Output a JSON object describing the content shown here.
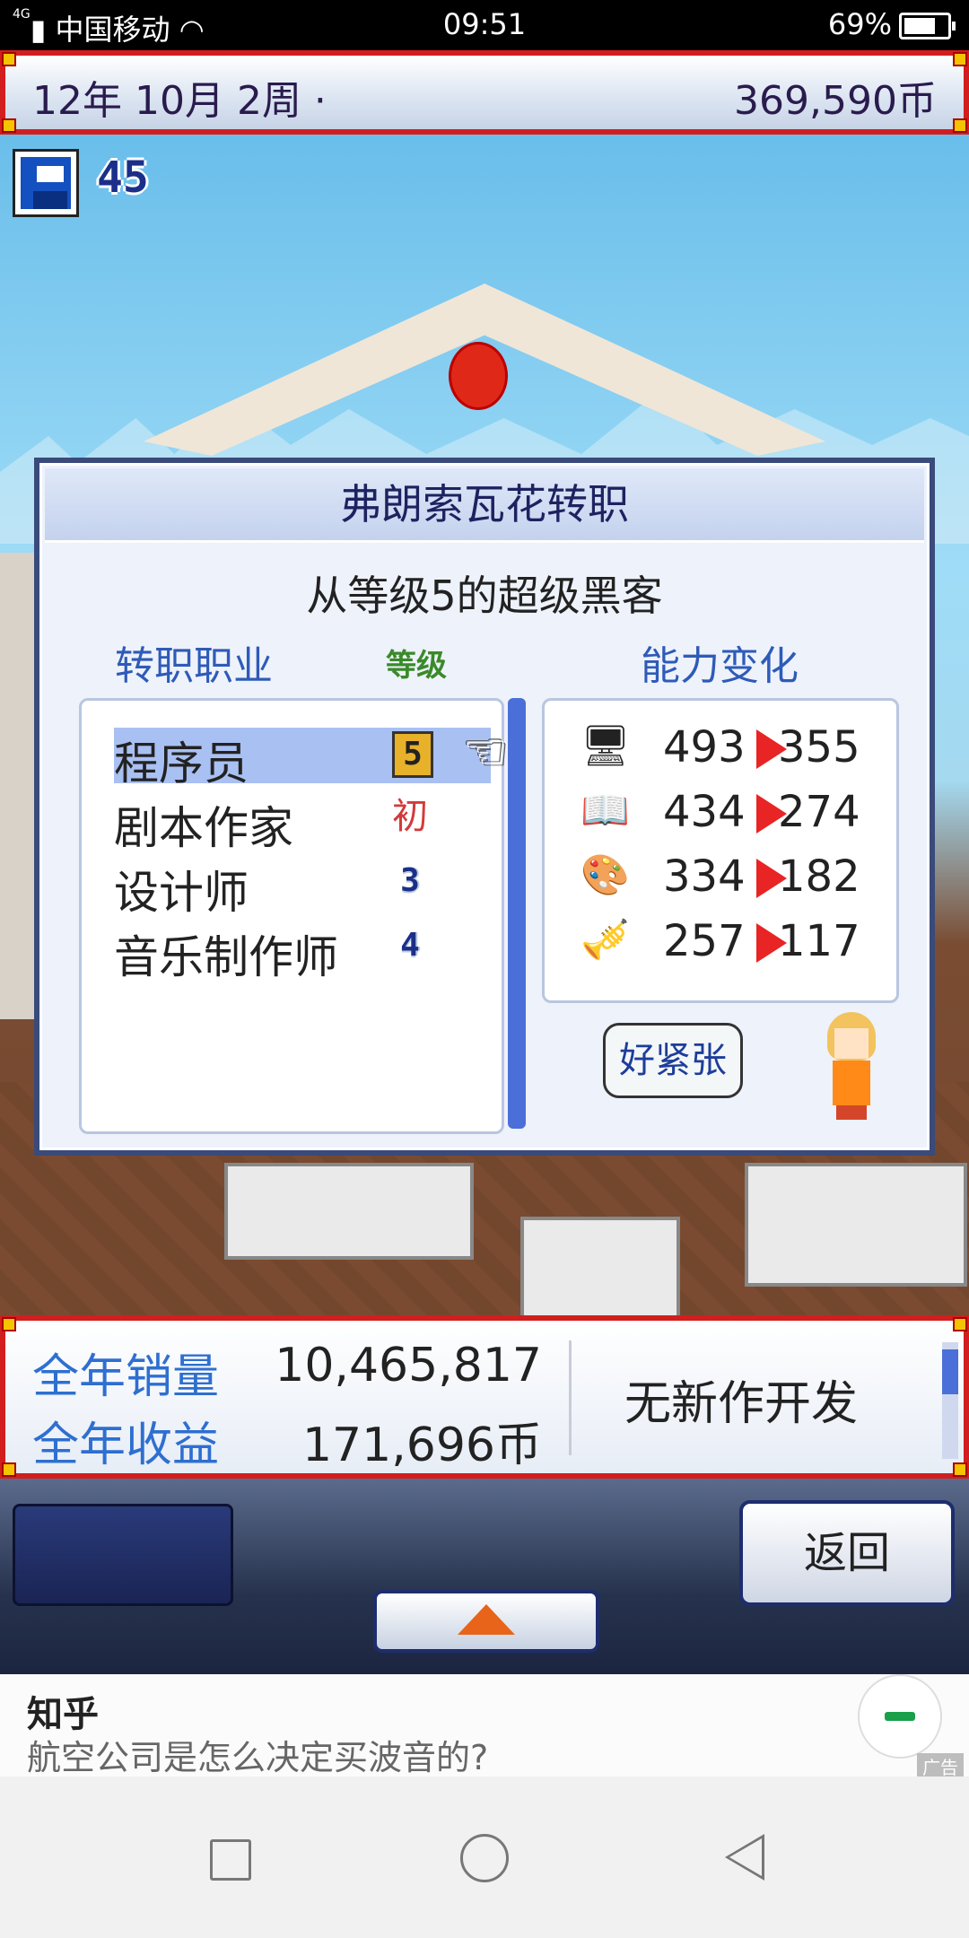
{
  "status_bar": {
    "network": "4G",
    "carrier": "中国移动",
    "time": "09:51",
    "battery": "69%"
  },
  "top_bar": {
    "date": "12年 10月 2周 ·",
    "money": "369,590币"
  },
  "save_counter": "45",
  "dialog": {
    "title": "弗朗索瓦花转职",
    "subtitle": "从等级5的超级黑客",
    "col_job": "转职职业",
    "col_level": "等级",
    "col_ability": "能力变化",
    "jobs": [
      {
        "name": "程序员",
        "level": "5",
        "selected": true
      },
      {
        "name": "剧本作家",
        "level": "初",
        "selected": false
      },
      {
        "name": "设计师",
        "level": "3",
        "selected": false
      },
      {
        "name": "音乐制作师",
        "level": "4",
        "selected": false
      }
    ],
    "stats": [
      {
        "icon": "computer-icon",
        "from": "493",
        "to": "355"
      },
      {
        "icon": "book-icon",
        "from": "434",
        "to": "274"
      },
      {
        "icon": "palette-icon",
        "from": "334",
        "to": "182"
      },
      {
        "icon": "trumpet-icon",
        "from": "257",
        "to": "117"
      }
    ],
    "speech": "好紧张"
  },
  "info_bar": {
    "annual_sales_label": "全年销量",
    "annual_sales_value": "10,465,817",
    "annual_profit_label": "全年收益",
    "annual_profit_value": "171,696币",
    "status": "无新作开发"
  },
  "controls": {
    "back_label": "返回"
  },
  "ad": {
    "brand": "知乎",
    "text": "航空公司是怎么决定买波音的?",
    "tag": "广告"
  },
  "colors": {
    "frame_red": "#d21e1e",
    "accent_blue": "#2e6fd0",
    "navy": "#1d2d6e"
  }
}
